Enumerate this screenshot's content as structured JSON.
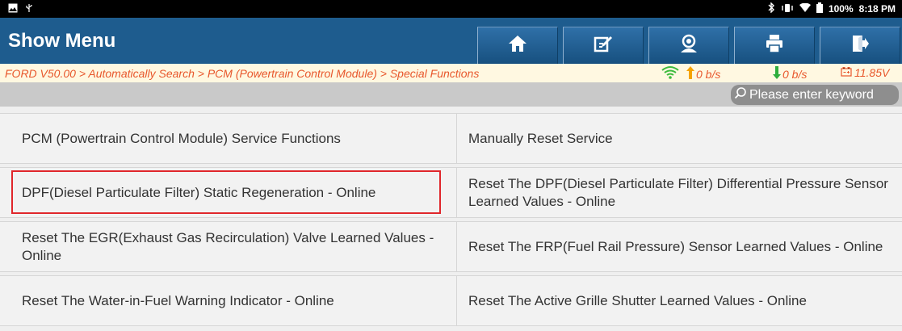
{
  "statusbar": {
    "left_icons": [
      "image-icon",
      "usb-icon"
    ],
    "right_icons": [
      "bluetooth-icon",
      "vibrate-icon",
      "wifi-icon",
      "battery-icon"
    ],
    "battery": "100%",
    "time": "8:18 PM"
  },
  "header": {
    "title": "Show Menu",
    "buttons": [
      "home-icon",
      "edit-icon",
      "user-icon",
      "print-icon",
      "exit-icon"
    ]
  },
  "breadcrumb": {
    "path": "FORD V50.00 > Automatically Search > PCM (Powertrain Control Module) > Special Functions",
    "upload": "0 b/s",
    "download": "0 b/s",
    "voltage": "11.85V"
  },
  "search": {
    "placeholder": "Please enter keyword"
  },
  "menu": {
    "rows": [
      {
        "left": "PCM (Powertrain Control Module) Service Functions",
        "right": "Manually Reset Service"
      },
      {
        "left": "DPF(Diesel Particulate Filter) Static Regeneration - Online",
        "right": "Reset The DPF(Diesel Particulate Filter) Differential Pressure Sensor Learned Values - Online"
      },
      {
        "left": "Reset The EGR(Exhaust Gas Recirculation) Valve Learned Values - Online",
        "right": "Reset The FRP(Fuel Rail Pressure) Sensor Learned Values - Online"
      },
      {
        "left": "Reset The Water-in-Fuel Warning Indicator - Online",
        "right": "Reset The Active Grille Shutter Learned Values - Online"
      }
    ]
  },
  "colors": {
    "header": "#1e5c8e",
    "crumb_text": "#e8572c",
    "crumb_bg": "#fff8e1",
    "highlight": "#e0262b",
    "up_arrow": "#f5a300",
    "down_arrow": "#2fae3d",
    "wifi": "#3dbb3d"
  }
}
